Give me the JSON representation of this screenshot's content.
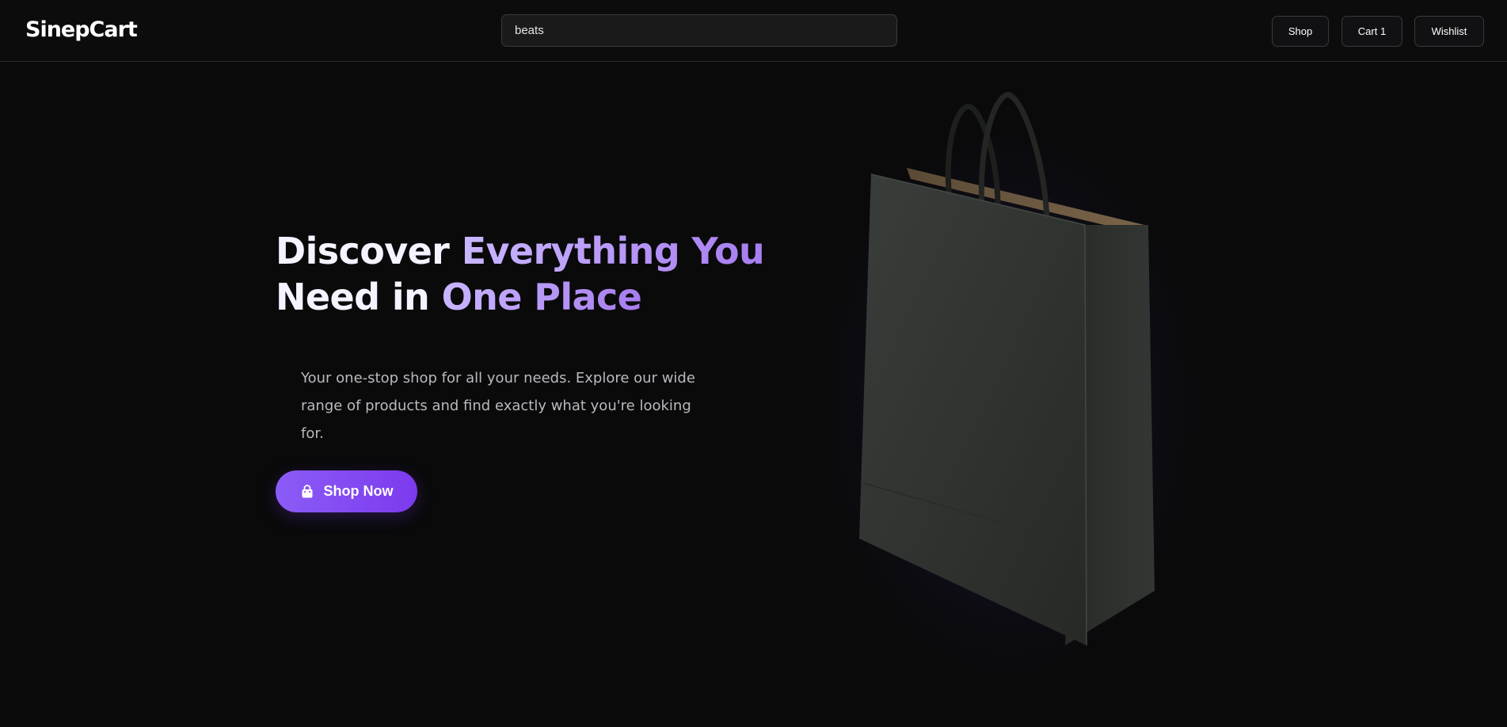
{
  "header": {
    "logo": "SinepCart",
    "search": {
      "value": "beats",
      "placeholder": ""
    },
    "nav": {
      "shop_label": "Shop",
      "cart_label": "Cart 1",
      "wishlist_label": "Wishlist"
    }
  },
  "hero": {
    "title_part1": "Discover ",
    "title_part2": "Everything You",
    "title_part3": "Need in ",
    "title_part4": "One Place",
    "subtitle": "Your one-stop shop for all your needs. Explore our wide range of products and find exactly what you're looking for.",
    "cta_label": "Shop Now",
    "cta_icon": "shopping-bag-icon",
    "image": "shopping-bag-photo"
  },
  "colors": {
    "background": "#0a0a0b",
    "accent": "#8b5cf6",
    "accent_dark": "#7c3aed",
    "title_gradient_start": "#c9b6ff",
    "title_gradient_end": "#a77cf0"
  }
}
